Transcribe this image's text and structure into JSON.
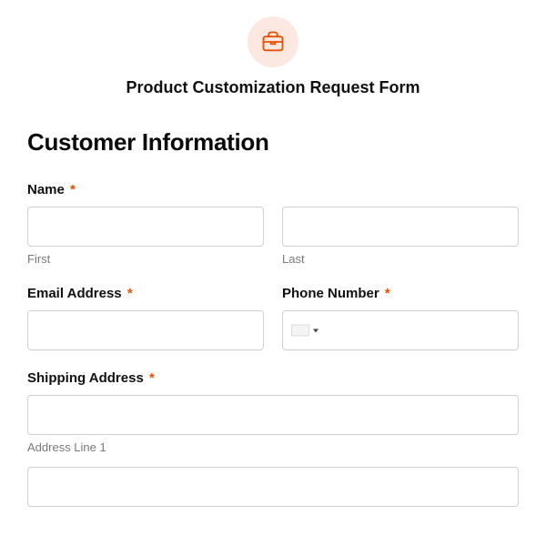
{
  "header": {
    "title": "Product Customization Request Form",
    "icon": "briefcase-icon"
  },
  "section": {
    "heading": "Customer Information"
  },
  "fields": {
    "name": {
      "label": "Name",
      "required_mark": "*",
      "first_sub": "First",
      "last_sub": "Last",
      "first_value": "",
      "last_value": ""
    },
    "email": {
      "label": "Email Address",
      "required_mark": "*",
      "value": ""
    },
    "phone": {
      "label": "Phone Number",
      "required_mark": "*",
      "value": ""
    },
    "shipping": {
      "label": "Shipping Address",
      "required_mark": "*",
      "line1_sub": "Address Line 1",
      "line1_value": "",
      "line2_value": ""
    }
  }
}
